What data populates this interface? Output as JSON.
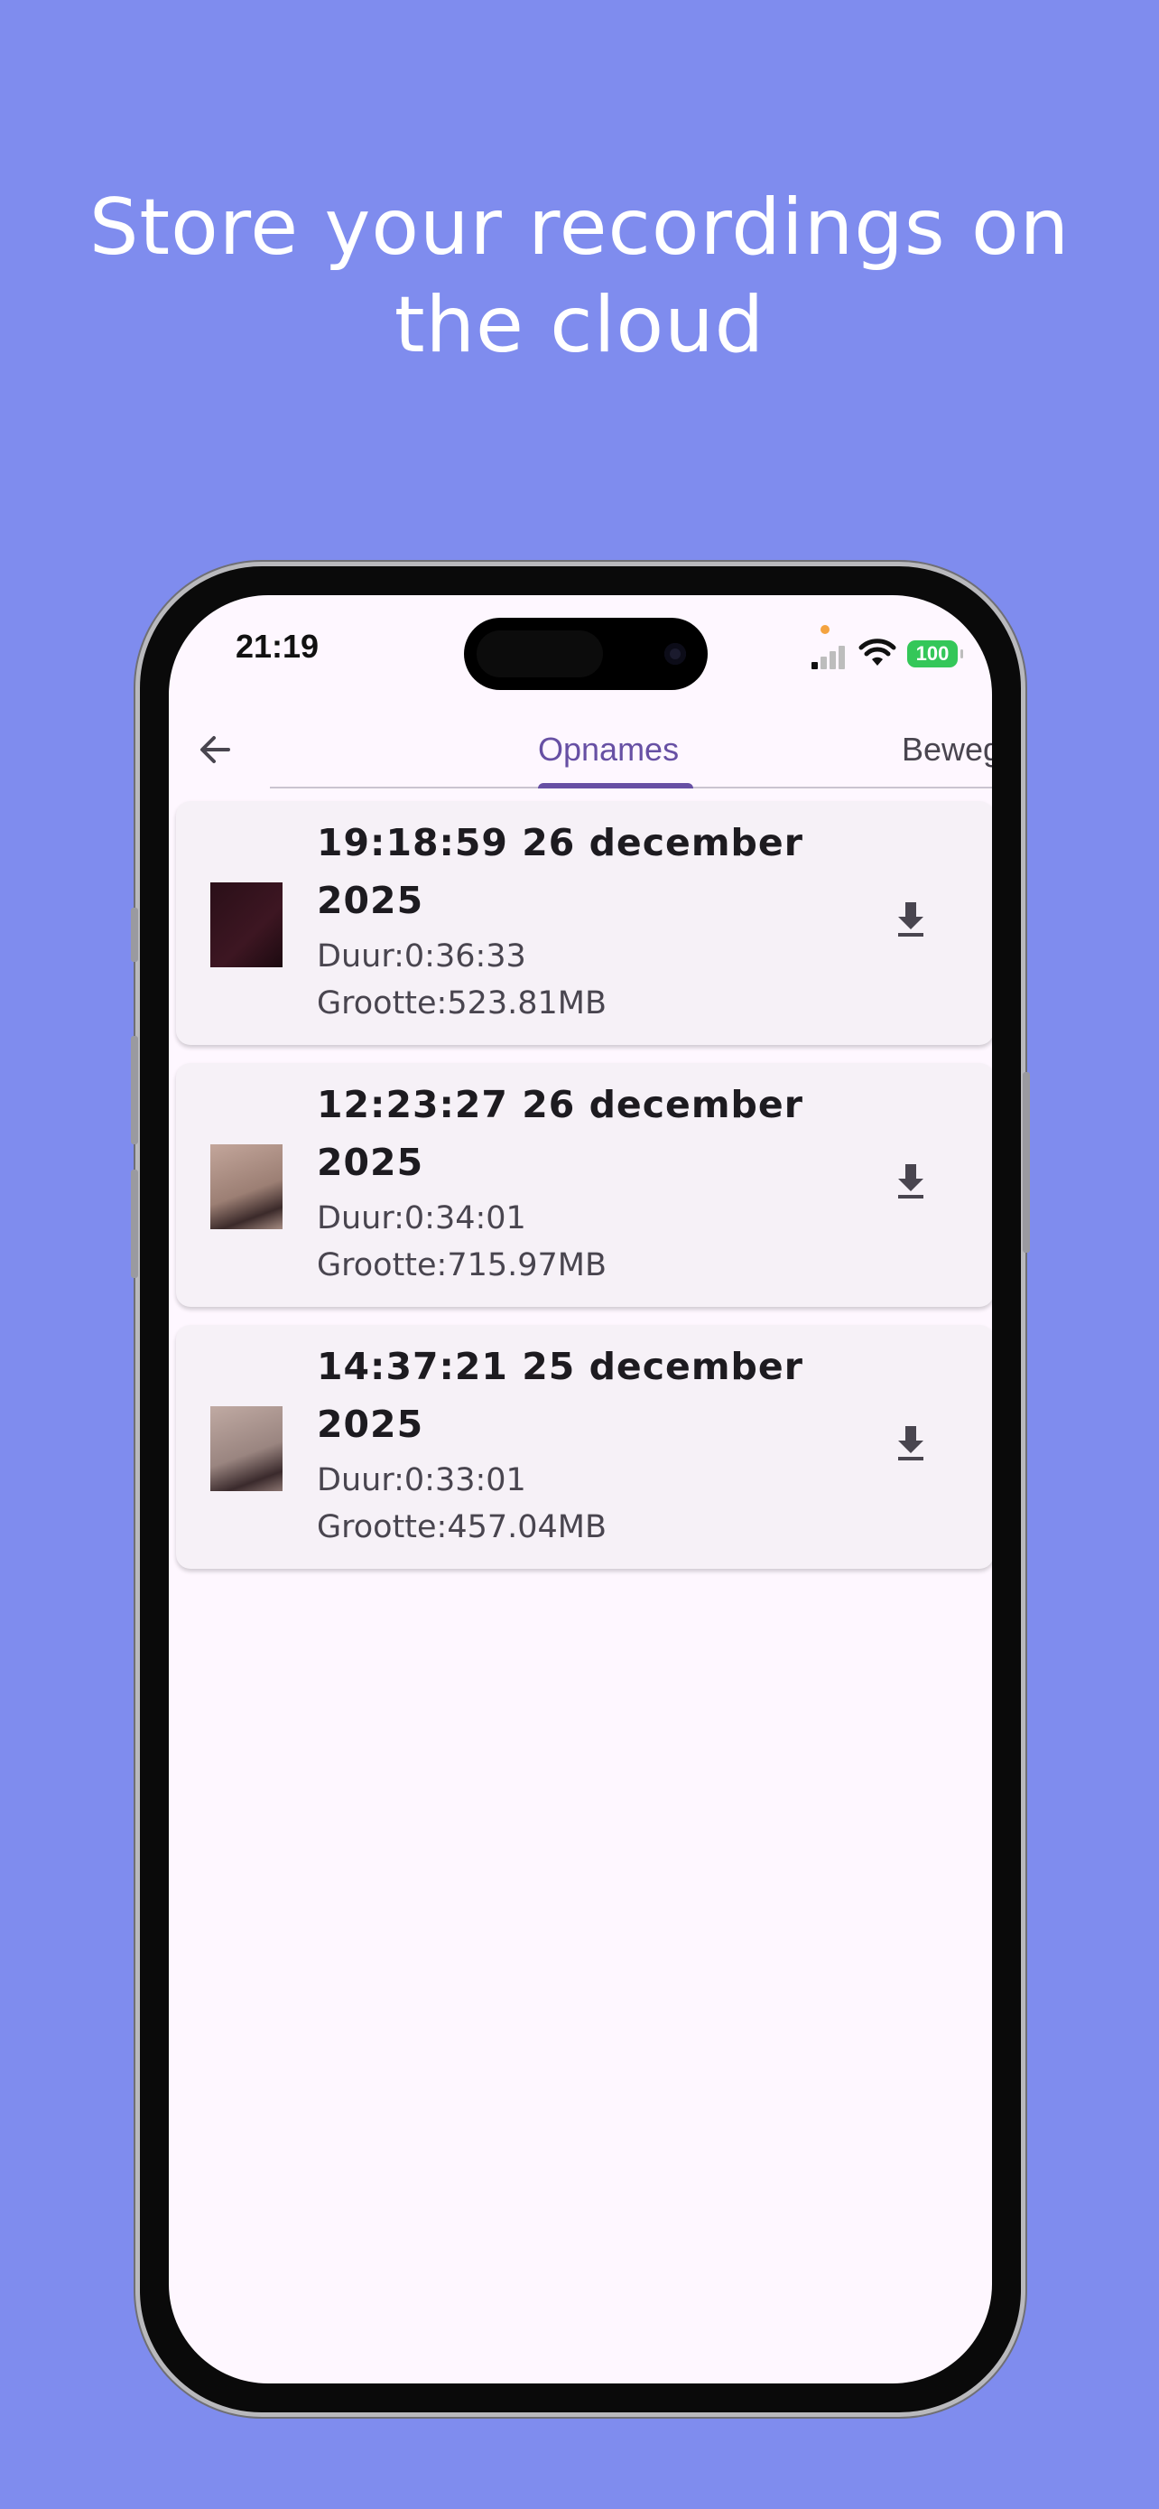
{
  "headline": {
    "line1": "Store your recordings on",
    "line2": "the cloud"
  },
  "status_bar": {
    "time": "21:19",
    "battery": "100"
  },
  "tabs": [
    {
      "label": "Opnames",
      "active": true
    },
    {
      "label": "Beweging",
      "active": false
    }
  ],
  "recordings": [
    {
      "title": "19:18:59 26 december 2025",
      "duration": "Duur:0:36:33",
      "size": "Grootte:523.81MB",
      "thumb_color": "#3a1520"
    },
    {
      "title": "12:23:27 26 december 2025",
      "duration": "Duur:0:34:01",
      "size": "Grootte:715.97MB",
      "thumb_color": "#9c7f74"
    },
    {
      "title": "14:37:21 25 december 2025",
      "duration": "Duur:0:33:01",
      "size": "Grootte:457.04MB",
      "thumb_color": "#9a8580"
    }
  ],
  "colors": {
    "background": "#7f8cee",
    "accent": "#6750a4",
    "screen": "#fef7ff",
    "card": "#f6f1f7"
  }
}
